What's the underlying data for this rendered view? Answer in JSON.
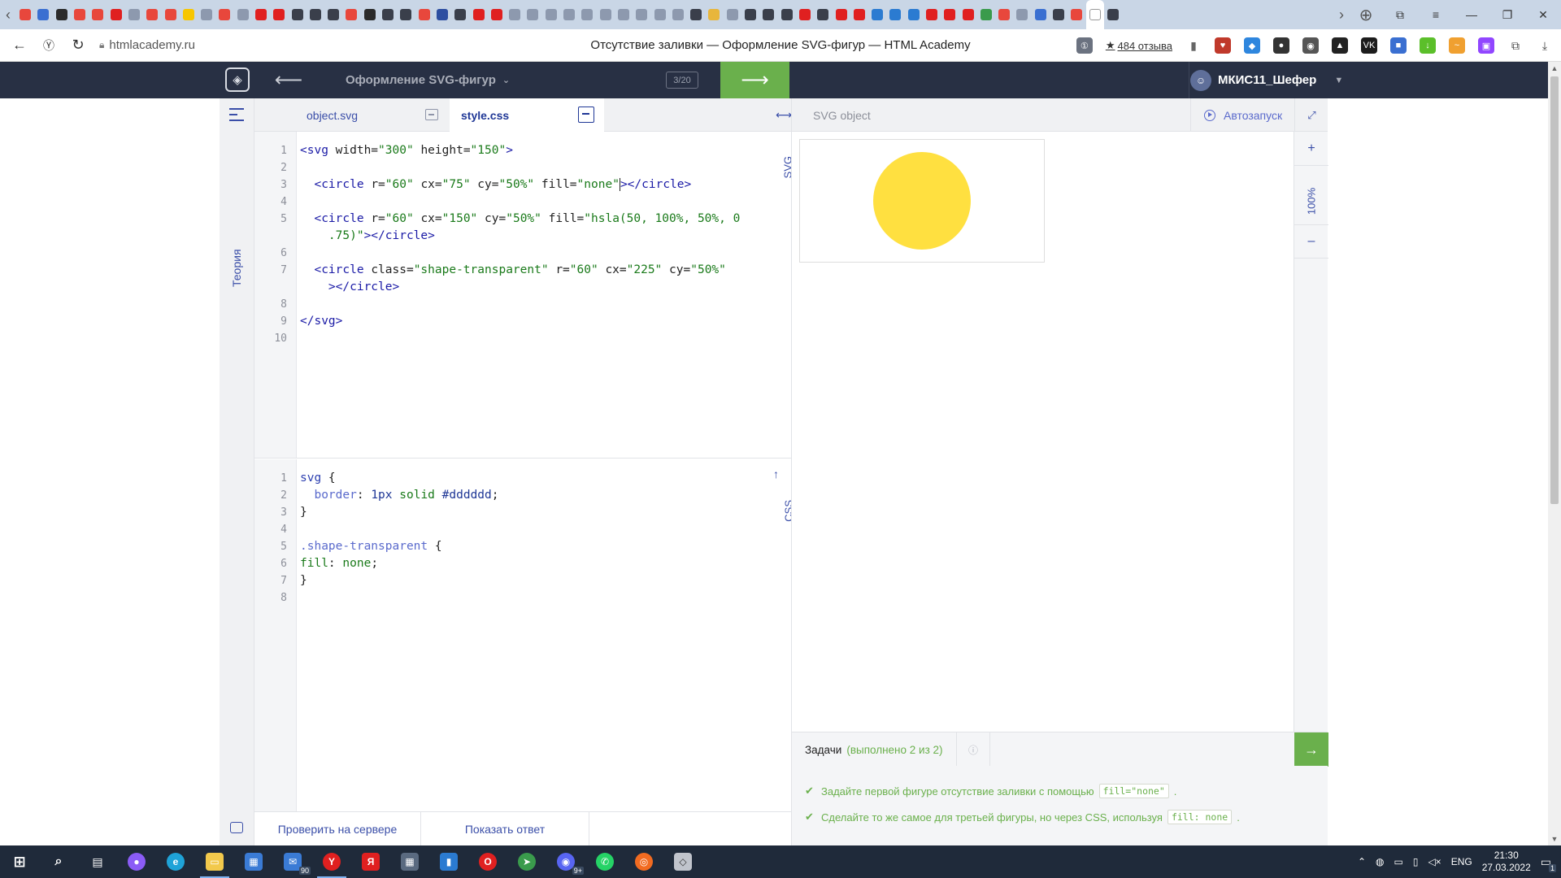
{
  "browser": {
    "url": "htmlacademy.ru",
    "page_title": "Отсутствие заливки — Оформление SVG-фигур — HTML Academy",
    "reviews": "484 отзыва",
    "tab_favicons": [
      "#e8473c",
      "#3a6fd1",
      "#2b2b2b",
      "#e8473c",
      "#e8473c",
      "#e02020",
      "#8d99ae",
      "#e8473c",
      "#e8473c",
      "#f7c600",
      "#8d99ae",
      "#e8473c",
      "#8d99ae",
      "#e02020",
      "#e02020",
      "#3a3f4b",
      "#3a3f4b",
      "#3a3f4b",
      "#e8473c",
      "#2b2b2b",
      "#3a3f4b",
      "#3a3f4b",
      "#e8473c",
      "#2d4ea1",
      "#3a3f4b",
      "#e02020",
      "#e02020",
      "#8d99ae",
      "#8d99ae",
      "#8d99ae",
      "#8d99ae",
      "#8d99ae",
      "#8d99ae",
      "#8d99ae",
      "#8d99ae",
      "#8d99ae",
      "#8d99ae",
      "#3a3f4b",
      "#e8b63c",
      "#8d99ae",
      "#3a3f4b",
      "#3a3f4b",
      "#3a3f4b",
      "#e02020",
      "#3a3f4b",
      "#e02020",
      "#e02020",
      "#2b7bd1",
      "#2b7bd1",
      "#2b7bd1",
      "#e02020",
      "#e02020",
      "#e02020",
      "#3a9b4c",
      "#e8473c",
      "#8d99ae",
      "#3a6fd1",
      "#3a3f4b",
      "#e8473c",
      "#ffffff",
      "#3a3f4b"
    ]
  },
  "app": {
    "course_title": "Оформление SVG-фигур",
    "step_counter": "3/20",
    "user_name": "МКИС11_Шефер",
    "theory_label": "Теория"
  },
  "editor": {
    "tabs": [
      {
        "label": "object.svg"
      },
      {
        "label": "style.css"
      }
    ],
    "svg_side_label": "SVG",
    "css_side_label": "CSS",
    "svg_line_numbers": [
      "1",
      "2",
      "3",
      "4",
      "5",
      "",
      "6",
      "7",
      "",
      "8",
      "9",
      "10"
    ],
    "css_line_numbers": [
      "1",
      "2",
      "3",
      "4",
      "5",
      "6",
      "7",
      "8"
    ]
  },
  "footer": {
    "check_label": "Проверить на сервере",
    "answer_label": "Показать ответ"
  },
  "preview": {
    "title": "SVG object",
    "autorun_label": "Автозапуск",
    "zoom_in": "+",
    "zoom_level": "100%",
    "zoom_out": "–",
    "circle_fill": "hsla(50, 100%, 50%, 0.75)"
  },
  "tasks": {
    "title": "Задачи",
    "progress": "(выполнено 2 из 2)",
    "items": [
      {
        "text": "Задайте первой фигуре отсутствие заливки с помощью",
        "code": "fill=\"none\"",
        "tail": "."
      },
      {
        "text": "Сделайте то же самое для третьей фигуры, но через CSS, используя",
        "code": "fill: none",
        "tail": "."
      }
    ]
  },
  "taskbar": {
    "time": "21:30",
    "date": "27.03.2022",
    "lang": "ENG",
    "mail_badge": "90",
    "discord_badge": "9+",
    "notif_badge": "1",
    "apps": [
      {
        "name": "start",
        "color": "#ffffff"
      },
      {
        "name": "search",
        "color": "#ffffff"
      },
      {
        "name": "task-view",
        "color": "#ffffff"
      },
      {
        "name": "alice",
        "color": "#8b5cf6"
      },
      {
        "name": "edge",
        "color": "#1fa3d8"
      },
      {
        "name": "explorer",
        "color": "#f2c94c"
      },
      {
        "name": "store",
        "color": "#3a7bd5"
      },
      {
        "name": "mail",
        "color": "#3a7bd5"
      },
      {
        "name": "yandex-browser",
        "color": "#e02020"
      },
      {
        "name": "yandex",
        "color": "#e02020"
      },
      {
        "name": "calculator",
        "color": "#5a6a80"
      },
      {
        "name": "notepad",
        "color": "#2b7bd1"
      },
      {
        "name": "opera",
        "color": "#e02020"
      },
      {
        "name": "telegram",
        "color": "#3a9b4c"
      },
      {
        "name": "discord",
        "color": "#5865f2"
      },
      {
        "name": "whatsapp",
        "color": "#25d366"
      },
      {
        "name": "origin",
        "color": "#f26b21"
      },
      {
        "name": "roblox",
        "color": "#c0c4cc"
      }
    ]
  }
}
